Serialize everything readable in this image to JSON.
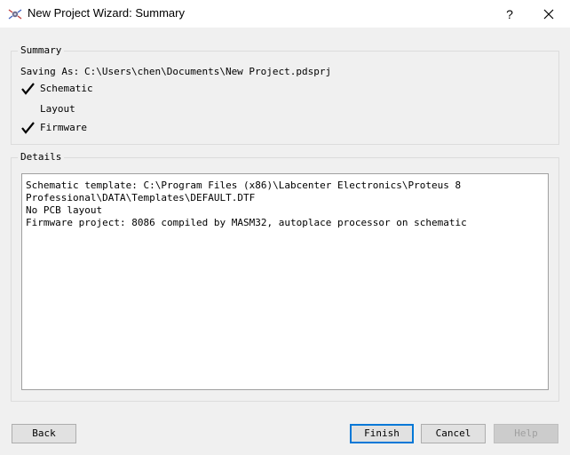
{
  "window": {
    "title": "New Project Wizard: Summary",
    "help_glyph": "?"
  },
  "summary": {
    "group_label": "Summary",
    "saving_as_label": "Saving As:",
    "saving_as_path": "C:\\Users\\chen\\Documents\\New Project.pdsprj",
    "items": [
      {
        "label": "Schematic",
        "checked": true
      },
      {
        "label": "Layout",
        "checked": false
      },
      {
        "label": "Firmware",
        "checked": true
      }
    ]
  },
  "details": {
    "group_label": "Details",
    "lines": [
      "Schematic template: C:\\Program Files (x86)\\Labcenter Electronics\\Proteus 8",
      "Professional\\DATA\\Templates\\DEFAULT.DTF",
      "No PCB layout",
      "Firmware project: 8086 compiled by MASM32, autoplace processor on schematic"
    ]
  },
  "buttons": {
    "back": "Back",
    "finish": "Finish",
    "cancel": "Cancel",
    "help": "Help"
  },
  "icons": {
    "app": "proteus-app-icon",
    "close": "close-icon",
    "check": "checkmark-icon"
  }
}
